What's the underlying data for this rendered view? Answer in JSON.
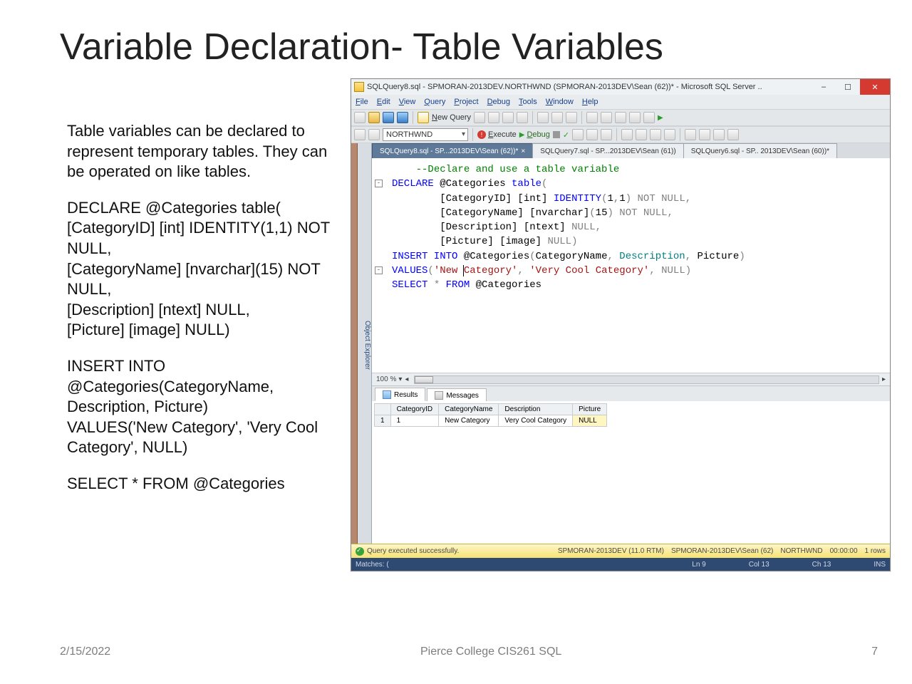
{
  "slide": {
    "title": "Variable Declaration- Table Variables",
    "body_intro": "Table variables can be declared to represent temporary tables. They can be operated on like tables.",
    "code1": "DECLARE @Categories table(\n[CategoryID] [int] IDENTITY(1,1) NOT NULL,\n[CategoryName] [nvarchar](15) NOT NULL,\n[Description] [ntext] NULL,\n[Picture] [image] NULL)",
    "code2": "INSERT INTO @Categories(CategoryName, Description, Picture)\nVALUES('New Category', 'Very Cool Category', NULL)",
    "code3": "SELECT * FROM @Categories",
    "footer_date": "2/15/2022",
    "footer_center": "Pierce College CIS261 SQL",
    "footer_page": "7"
  },
  "ssms": {
    "window_title": "SQLQuery8.sql - SPMORAN-2013DEV.NORTHWND (SPMORAN-2013DEV\\Sean (62))* - Microsoft SQL Server ..",
    "menus": [
      "File",
      "Edit",
      "View",
      "Query",
      "Project",
      "Debug",
      "Tools",
      "Window",
      "Help"
    ],
    "toolbar": {
      "new_query": "New Query",
      "database": "NORTHWND",
      "execute": "Execute",
      "debug": "Debug"
    },
    "object_explorer_tab": "Object Explorer",
    "tabs": [
      {
        "label": "SQLQuery8.sql - SP...2013DEV\\Sean (62))*",
        "active": true,
        "closable": true
      },
      {
        "label": "SQLQuery7.sql - SP...2013DEV\\Sean (61))",
        "active": false,
        "closable": false
      },
      {
        "label": "SQLQuery6.sql - SP.. 2013DEV\\Sean (60))*",
        "active": false,
        "closable": false
      }
    ],
    "code_lines": [
      {
        "indent": 1,
        "tokens": [
          {
            "t": "--Declare and use a table variable",
            "c": "kw-green"
          }
        ]
      },
      {
        "indent": 0,
        "fold": "-",
        "tokens": [
          {
            "t": "DECLARE",
            "c": "kw-blue"
          },
          {
            "t": " @Categories ",
            "c": "kw-black"
          },
          {
            "t": "table",
            "c": "kw-blue"
          },
          {
            "t": "(",
            "c": "kw-gray"
          }
        ]
      },
      {
        "indent": 2,
        "tokens": [
          {
            "t": "[CategoryID] [int] ",
            "c": "kw-black"
          },
          {
            "t": "IDENTITY",
            "c": "kw-blue"
          },
          {
            "t": "(",
            "c": "kw-gray"
          },
          {
            "t": "1",
            "c": "kw-black"
          },
          {
            "t": ",",
            "c": "kw-gray"
          },
          {
            "t": "1",
            "c": "kw-black"
          },
          {
            "t": ")",
            "c": "kw-gray"
          },
          {
            "t": " NOT NULL",
            "c": "kw-gray"
          },
          {
            "t": ",",
            "c": "kw-gray"
          }
        ]
      },
      {
        "indent": 2,
        "tokens": [
          {
            "t": "[CategoryName] [nvarchar]",
            "c": "kw-black"
          },
          {
            "t": "(",
            "c": "kw-gray"
          },
          {
            "t": "15",
            "c": "kw-black"
          },
          {
            "t": ")",
            "c": "kw-gray"
          },
          {
            "t": " NOT NULL",
            "c": "kw-gray"
          },
          {
            "t": ",",
            "c": "kw-gray"
          }
        ]
      },
      {
        "indent": 2,
        "tokens": [
          {
            "t": "[Description] [ntext] ",
            "c": "kw-black"
          },
          {
            "t": "NULL",
            "c": "kw-gray"
          },
          {
            "t": ",",
            "c": "kw-gray"
          }
        ]
      },
      {
        "indent": 2,
        "tokens": [
          {
            "t": "[Picture] [image] ",
            "c": "kw-black"
          },
          {
            "t": "NULL",
            "c": "kw-gray"
          },
          {
            "t": ")",
            "c": "kw-gray"
          }
        ]
      },
      {
        "indent": 0,
        "tokens": [
          {
            "t": " ",
            "c": "kw-black"
          }
        ]
      },
      {
        "indent": 0,
        "fold": "-",
        "tokens": [
          {
            "t": "INSERT INTO",
            "c": "kw-blue"
          },
          {
            "t": " @Categories",
            "c": "kw-black"
          },
          {
            "t": "(",
            "c": "kw-gray"
          },
          {
            "t": "CategoryName",
            "c": "kw-black"
          },
          {
            "t": ",",
            "c": "kw-gray"
          },
          {
            "t": " Description",
            "c": "kw-teal"
          },
          {
            "t": ",",
            "c": "kw-gray"
          },
          {
            "t": " Picture",
            "c": "kw-black"
          },
          {
            "t": ")",
            "c": "kw-gray"
          }
        ]
      },
      {
        "indent": 0,
        "tokens": [
          {
            "t": "VALUES",
            "c": "kw-blue"
          },
          {
            "t": "(",
            "c": "kw-gray"
          },
          {
            "t": "'New ",
            "c": "kw-red"
          },
          {
            "t": "|",
            "c": "caret"
          },
          {
            "t": "Category'",
            "c": "kw-red"
          },
          {
            "t": ",",
            "c": "kw-gray"
          },
          {
            "t": " 'Very Cool Category'",
            "c": "kw-red"
          },
          {
            "t": ",",
            "c": "kw-gray"
          },
          {
            "t": " NULL",
            "c": "kw-gray"
          },
          {
            "t": ")",
            "c": "kw-gray"
          }
        ]
      },
      {
        "indent": 0,
        "tokens": [
          {
            "t": " ",
            "c": "kw-black"
          }
        ]
      },
      {
        "indent": 0,
        "tokens": [
          {
            "t": "SELECT",
            "c": "kw-blue"
          },
          {
            "t": " *",
            "c": "kw-gray"
          },
          {
            "t": " FROM",
            "c": "kw-blue"
          },
          {
            "t": " @Categories",
            "c": "kw-black"
          }
        ]
      }
    ],
    "zoom": "100 %",
    "result_tabs": {
      "results": "Results",
      "messages": "Messages"
    },
    "results": {
      "headers": [
        "CategoryID",
        "CategoryName",
        "Description",
        "Picture"
      ],
      "rows": [
        {
          "n": "1",
          "cells": [
            "1",
            "New Category",
            "Very Cool Category",
            "NULL"
          ]
        }
      ]
    },
    "status": {
      "ok": "Query executed successfully.",
      "server": "SPMORAN-2013DEV (11.0 RTM)",
      "user": "SPMORAN-2013DEV\\Sean (62)",
      "db": "NORTHWND",
      "time": "00:00:00",
      "rows": "1 rows"
    },
    "bottombar": {
      "matches": "Matches: (",
      "ln": "Ln 9",
      "col": "Col 13",
      "ch": "Ch 13",
      "ins": "INS"
    }
  }
}
